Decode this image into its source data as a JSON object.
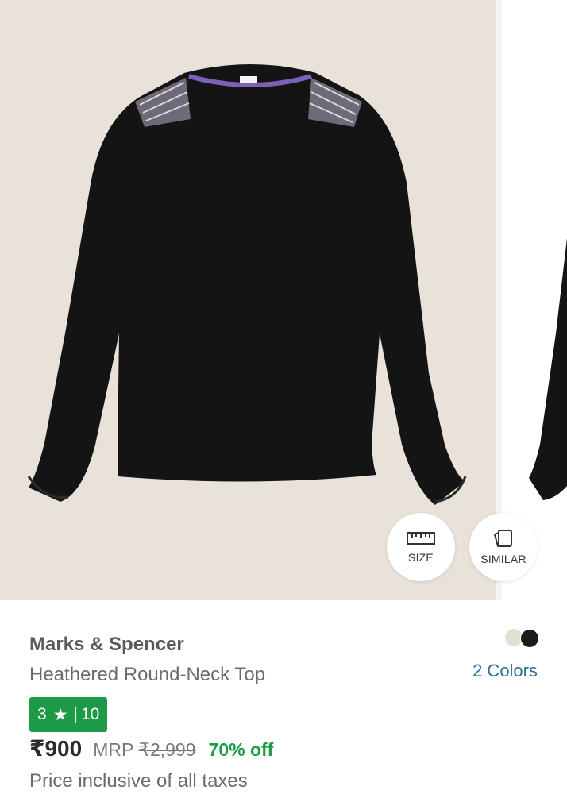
{
  "gallery": {
    "actions": {
      "size_label": "SIZE",
      "similar_label": "SIMILAR"
    },
    "background_color": "#e9e2da",
    "garment_color": "#141414"
  },
  "product": {
    "brand": "Marks & Spencer",
    "title": "Heathered Round-Neck Top",
    "colors_link": "2 Colors",
    "swatches": [
      "#e4ded3",
      "#1b1b1b"
    ],
    "rating": {
      "value": "3",
      "star": "★",
      "separator": "|",
      "count": "10",
      "color": "#1c9a45"
    },
    "price": "₹900",
    "mrp_label": "MRP",
    "mrp_value": "₹2,999",
    "discount": "70% off",
    "tax_note": "Price inclusive of all taxes",
    "link_color": "#2f6f94"
  }
}
